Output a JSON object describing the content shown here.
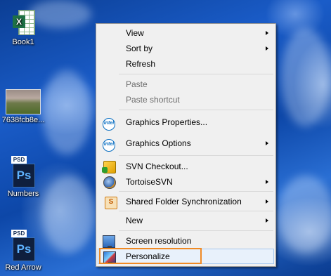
{
  "desktop": {
    "icons": [
      {
        "label": "Book1",
        "type": "excel",
        "badge": "X"
      },
      {
        "label": "7638fcb8e...",
        "type": "image-thumbnail"
      },
      {
        "label": "Numbers",
        "type": "psd",
        "tag": "PSD",
        "glyph": "Ps"
      },
      {
        "label": "Red Arrow",
        "type": "psd",
        "tag": "PSD",
        "glyph": "Ps"
      }
    ]
  },
  "context_menu": {
    "items": [
      {
        "label": "View",
        "submenu": true,
        "enabled": true
      },
      {
        "label": "Sort by",
        "submenu": true,
        "enabled": true
      },
      {
        "label": "Refresh",
        "submenu": false,
        "enabled": true
      },
      {
        "label": "Paste",
        "submenu": false,
        "enabled": false
      },
      {
        "label": "Paste shortcut",
        "submenu": false,
        "enabled": false
      },
      {
        "label": "Graphics Properties...",
        "icon": "intel-icon",
        "submenu": false,
        "enabled": true
      },
      {
        "label": "Graphics Options",
        "icon": "intel-icon",
        "submenu": true,
        "enabled": true
      },
      {
        "label": "SVN Checkout...",
        "icon": "svn-checkout-icon",
        "submenu": false,
        "enabled": true
      },
      {
        "label": "TortoiseSVN",
        "icon": "tortoisesvn-icon",
        "submenu": true,
        "enabled": true
      },
      {
        "label": "Shared Folder Synchronization",
        "icon": "shared-folder-icon",
        "submenu": true,
        "enabled": true
      },
      {
        "label": "New",
        "submenu": true,
        "enabled": true
      },
      {
        "label": "Screen resolution",
        "icon": "screen-resolution-icon",
        "submenu": false,
        "enabled": true
      },
      {
        "label": "Personalize",
        "icon": "personalize-icon",
        "submenu": false,
        "enabled": true,
        "hovered": true
      }
    ],
    "intel_glyph": "intel",
    "shared_glyph": "S"
  },
  "colors": {
    "menu_bg": "#f0f0f0",
    "highlight_bg": "#e8f1fb",
    "highlight_border": "#a6c8ee",
    "annotation": "#f08a24",
    "desktop_blue": "#1a5cc8"
  }
}
